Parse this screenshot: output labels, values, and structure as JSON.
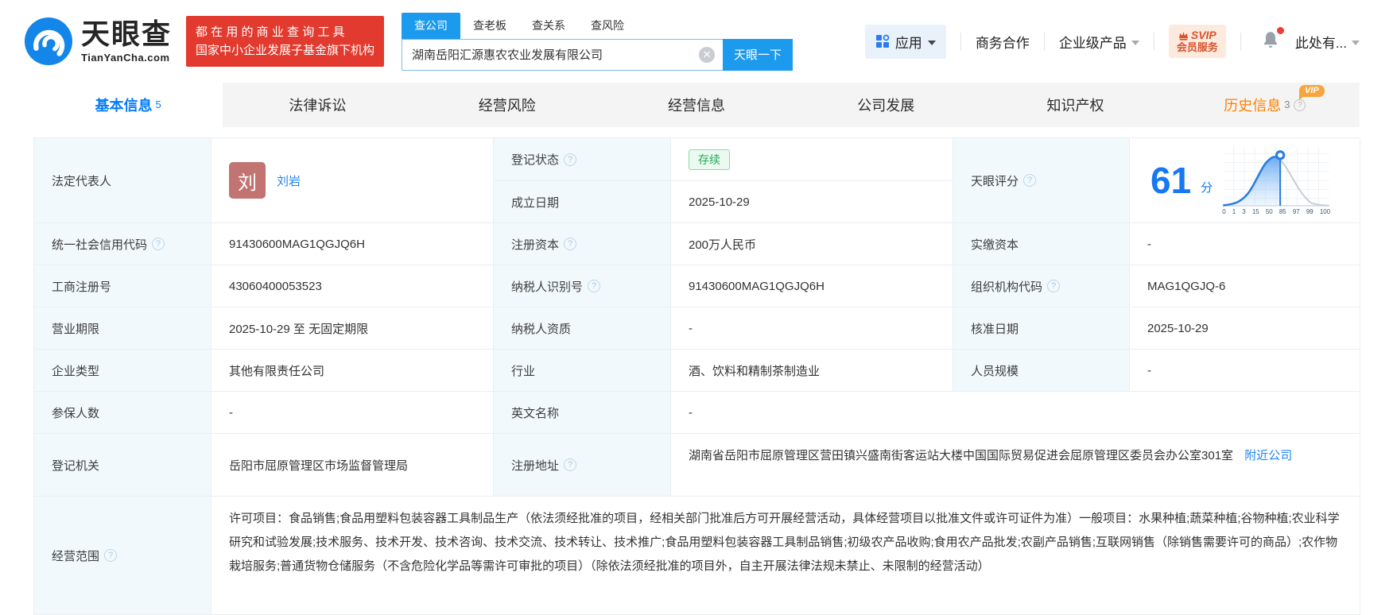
{
  "header": {
    "brand": {
      "name": "天眼查",
      "domain": "TianYanCha.com"
    },
    "promo": {
      "line1": "都 在 用 的 商 业 查 询 工 具",
      "line2": "国家中小企业发展子基金旗下机构"
    },
    "search": {
      "tabs": [
        "查公司",
        "查老板",
        "查关系",
        "查风险"
      ],
      "value": "湖南岳阳汇源惠农农业发展有限公司",
      "clear": "✕",
      "button": "天眼一下"
    },
    "nav": {
      "apps": "应用",
      "cooperation": "商务合作",
      "enterprise": "企业级产品",
      "svip_top": "SVIP",
      "svip_bottom": "会员服务",
      "account": "此处有..."
    }
  },
  "tabs": [
    {
      "label": "基本信息",
      "count": "5"
    },
    {
      "label": "法律诉讼"
    },
    {
      "label": "经营风险"
    },
    {
      "label": "经营信息"
    },
    {
      "label": "公司发展"
    },
    {
      "label": "知识产权"
    },
    {
      "label": "历史信息",
      "count": "3",
      "vip": "VIP"
    }
  ],
  "fields": {
    "legal_rep": {
      "label": "法定代表人",
      "avatar": "刘",
      "name": "刘岩"
    },
    "reg_status": {
      "label": "登记状态",
      "value": "存续"
    },
    "est_date": {
      "label": "成立日期",
      "value": "2025-10-29"
    },
    "score": {
      "label": "天眼评分",
      "value": "61",
      "unit": "分"
    },
    "credit_code": {
      "label": "统一社会信用代码",
      "value": "91430600MAG1QGJQ6H"
    },
    "reg_capital": {
      "label": "注册资本",
      "value": "200万人民币"
    },
    "paid_capital": {
      "label": "实缴资本",
      "value": "-"
    },
    "reg_number": {
      "label": "工商注册号",
      "value": "43060400053523"
    },
    "taxpayer_id": {
      "label": "纳税人识别号",
      "value": "91430600MAG1QGJQ6H"
    },
    "org_code": {
      "label": "组织机构代码",
      "value": "MAG1QGJQ-6"
    },
    "business_term": {
      "label": "营业期限",
      "value": "2025-10-29 至 无固定期限"
    },
    "taxpayer_quality": {
      "label": "纳税人资质",
      "value": "-"
    },
    "approval_date": {
      "label": "核准日期",
      "value": "2025-10-29"
    },
    "company_type": {
      "label": "企业类型",
      "value": "其他有限责任公司"
    },
    "industry": {
      "label": "行业",
      "value": "酒、饮料和精制茶制造业"
    },
    "staff_size": {
      "label": "人员规模",
      "value": "-"
    },
    "insured_count": {
      "label": "参保人数",
      "value": "-"
    },
    "english_name": {
      "label": "英文名称",
      "value": "-"
    },
    "reg_authority": {
      "label": "登记机关",
      "value": "岳阳市屈原管理区市场监督管理局"
    },
    "reg_address": {
      "label": "注册地址",
      "value": "湖南省岳阳市屈原管理区营田镇兴盛南街客运站大楼中国国际贸易促进会屈原管理区委员会办公室301室",
      "link": "附近公司"
    },
    "business_scope": {
      "label": "经营范围",
      "value": "许可项目：食品销售;食品用塑料包装容器工具制品生产（依法须经批准的项目，经相关部门批准后方可开展经营活动，具体经营项目以批准文件或许可证件为准）一般项目：水果种植;蔬菜种植;谷物种植;农业科学研究和试验发展;技术服务、技术开发、技术咨询、技术交流、技术转让、技术推广;食品用塑料包装容器工具制品销售;初级农产品收购;食用农产品批发;农副产品销售;互联网销售（除销售需要许可的商品）;农作物栽培服务;普通货物仓储服务（不含危险化学品等需许可审批的项目）（除依法须经批准的项目外，自主开展法律法规未禁止、未限制的经营活动）"
    }
  },
  "chart_data": {
    "type": "area",
    "title": "天眼评分分布曲线",
    "x_ticks": [
      "0",
      "1",
      "3",
      "15",
      "50",
      "85",
      "97",
      "99",
      "100"
    ],
    "marker_value": 61,
    "legend_position": "none",
    "grid": true
  },
  "colors": {
    "accent_blue": "#1b9aee",
    "link_blue": "#2086ee",
    "score_blue": "#1678f2",
    "status_green": "#2aa558",
    "history_orange": "#ff8000",
    "promo_red": "#e23a2e",
    "avatar_red": "#c17472"
  }
}
